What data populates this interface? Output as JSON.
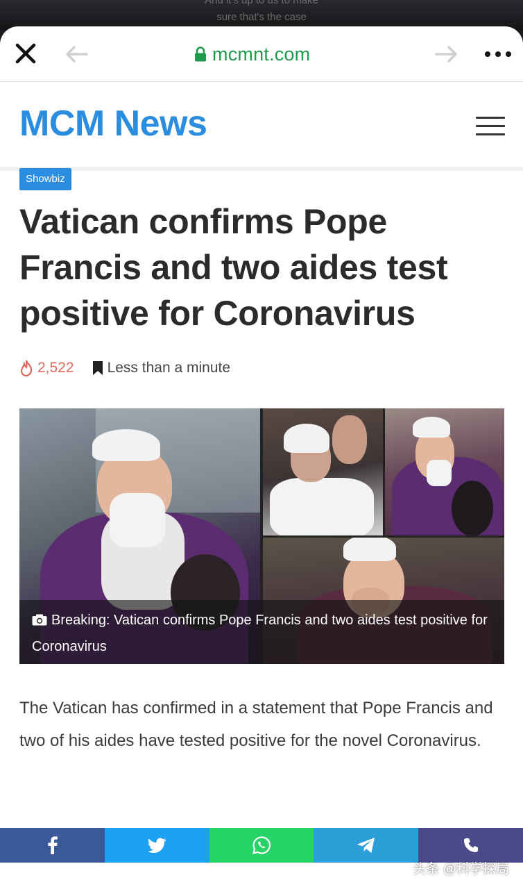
{
  "video_caption": {
    "line1": "And it's up to us to make",
    "line2": "sure that's the case"
  },
  "browser": {
    "url": "mcmnt.com",
    "url_color": "#1f9a4b"
  },
  "site": {
    "title": "MCM News",
    "brand_color": "#2a8de0"
  },
  "article": {
    "category": "Showbiz",
    "headline": "Vatican confirms Pope Francis and two aides test positive for Coronavirus",
    "views": "2,522",
    "read_time": "Less than a minute",
    "image_caption": "Breaking: Vatican confirms Pope Francis and two aides test positive for Coronavirus",
    "body": "The Vatican has confirmed in a statement that Pope Francis and two of his aides have tested positive for the novel Coronavirus."
  },
  "share": {
    "buttons": [
      {
        "icon": "facebook-icon",
        "color": "#3b5998"
      },
      {
        "icon": "twitter-icon",
        "color": "#1da1f2"
      },
      {
        "icon": "whatsapp-icon",
        "color": "#25d366"
      },
      {
        "icon": "telegram-icon",
        "color": "#2c9fd9"
      },
      {
        "icon": "phone-icon",
        "color": "#4a4a8a"
      }
    ]
  },
  "watermark": "头条 @科学探局"
}
